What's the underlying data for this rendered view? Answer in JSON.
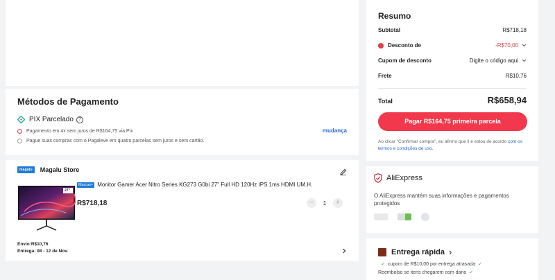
{
  "payment": {
    "title": "Métodos de Pagamento",
    "method_label": "PIX Parcelado",
    "help_glyph": "?",
    "note1": "Pagamento em 4x sem juros de R$164,75 via Pix",
    "note2": "Pague suas compras com o Pagaleve em quatro parcelas sem juros e sem cartão.",
    "change_link": "mudança"
  },
  "store": {
    "logo_text": "magalu",
    "name": "Magalu Store",
    "badge": "Marcas+",
    "product_title": "Monitor Gamer Acer Nitro Series KG273 G0bi 27\" Full HD 120Hz IPS 1ms HDMI UM.H.",
    "monitor_size_label": "27\"",
    "price": "R$718,18",
    "qty": "1",
    "minus": "−",
    "plus": "+",
    "shipping": "Envio:R$10,76",
    "delivery": "Entrega: 08 - 12 de Nov."
  },
  "summary": {
    "title": "Resumo",
    "subtotal_label": "Subtotal",
    "subtotal_value": "R$718,18",
    "discount_label": "Desconto de",
    "discount_value": "-R$70,00",
    "coupon_label": "Cupom de desconto",
    "coupon_value": "Digite o código aqui",
    "shipping_label": "Frete",
    "shipping_value": "R$10,76",
    "total_label": "Total",
    "total_value": "R$658,94",
    "pay_button": "Pagar R$164,75 primeira parcela",
    "terms_prefix": "Ao clicar \"Confirmar compra\", eu afirmo que li e estou de acordo ",
    "terms_link": "com os termos e condições de uso",
    "terms_suffix": "."
  },
  "aliexpress": {
    "brand": "AliExpress",
    "text": "O AliExpress mantém suas informações e pagamentos protegidos"
  },
  "delivery": {
    "title": "Entrega rápida",
    "chevron": "›",
    "line1": "cupom de R$10,00 por entrega atrasada",
    "line2": "Reembolso se itens chegarem com dano"
  },
  "colors": {
    "accent_red": "#f1384c",
    "link_blue": "#2166d6",
    "brand_blue": "#1f7bd6"
  }
}
